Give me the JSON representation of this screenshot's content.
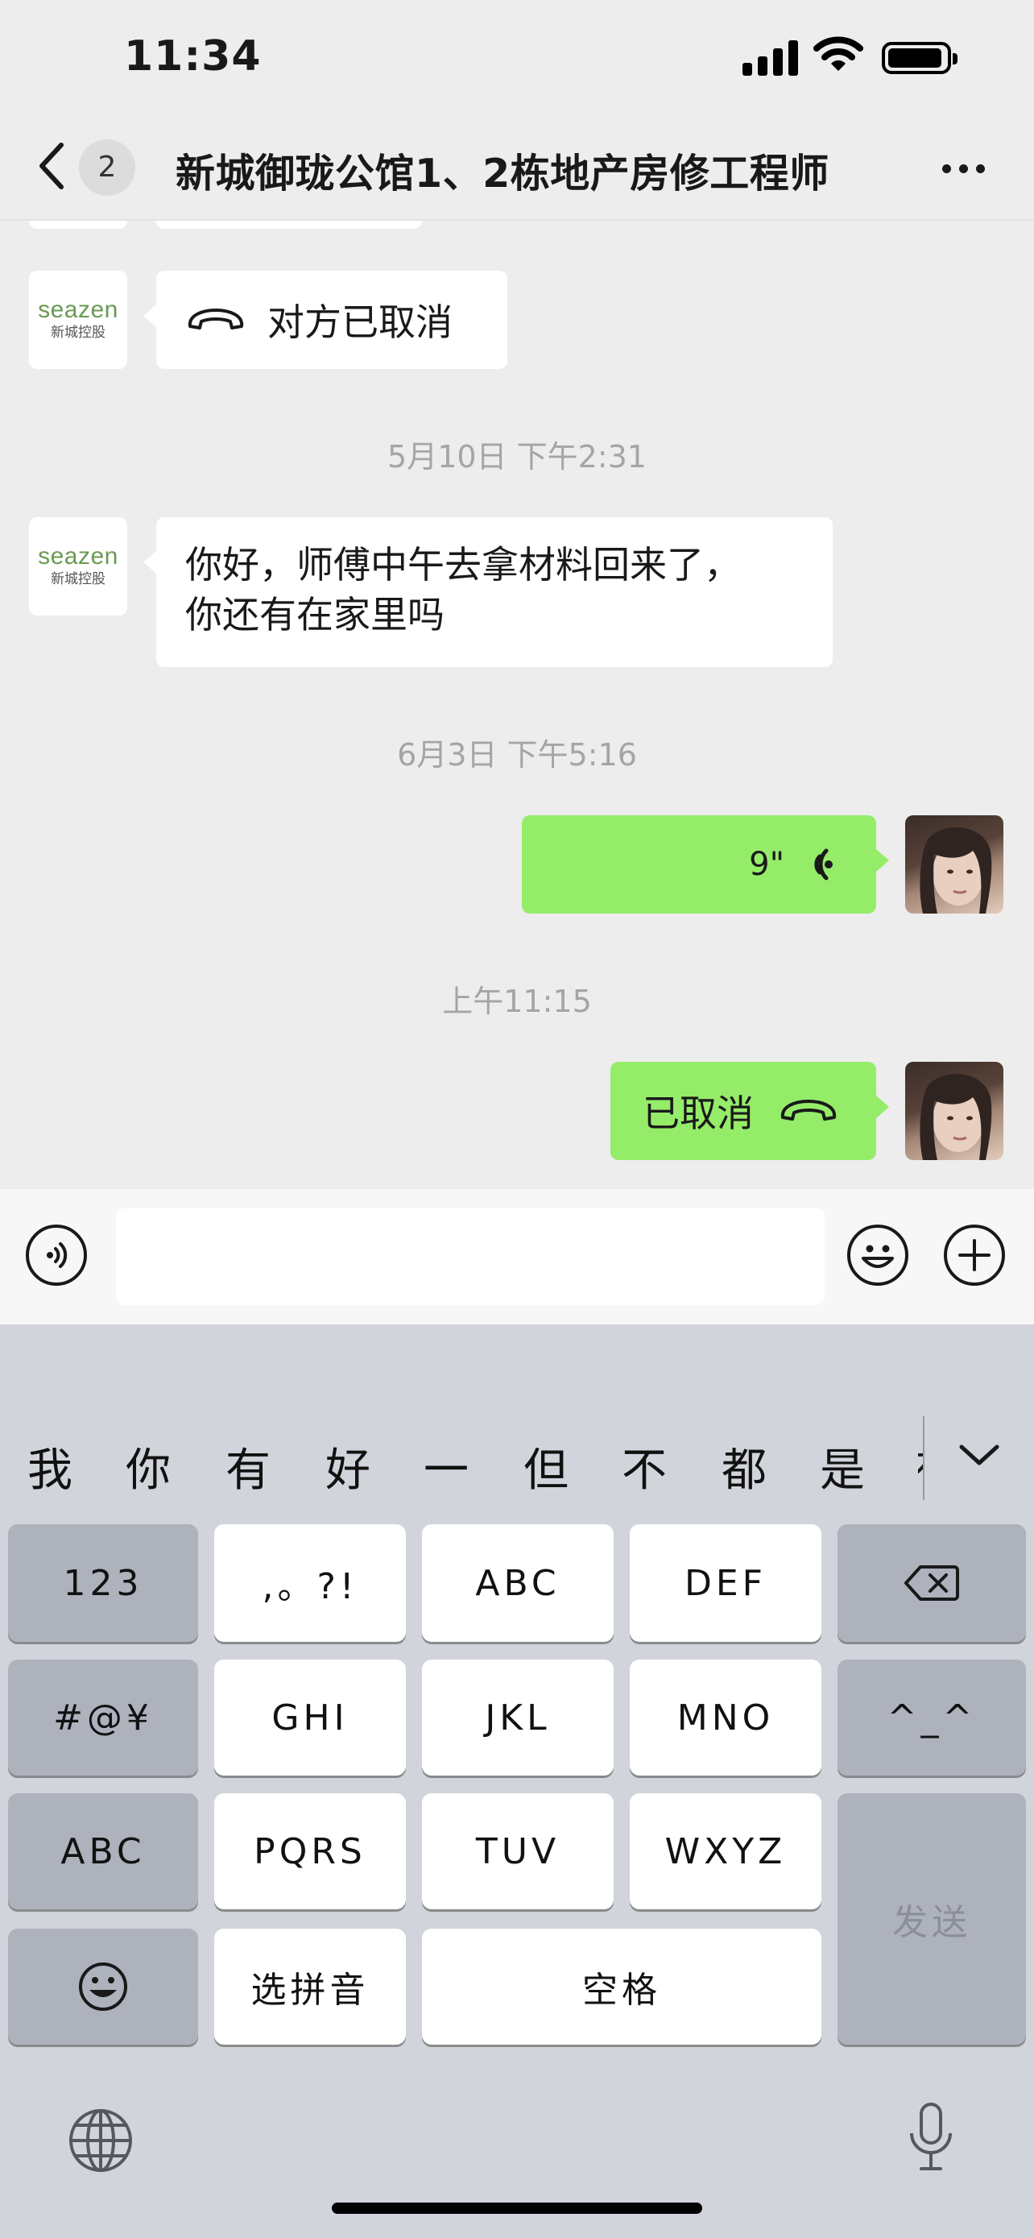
{
  "status_bar": {
    "time": "11:34"
  },
  "nav": {
    "unread_count": "2",
    "title": "新城御珑公馆1、2栋地产房修工程师"
  },
  "avatar_seazen": {
    "en": "seazen",
    "cn": "新城控股"
  },
  "messages": {
    "call_cancelled_other": "对方已取消",
    "ts_1": "5月10日 下午2:31",
    "text_1_line1": "你好，师傅中午去拿材料回来了，",
    "text_1_line2": "你还有在家里吗",
    "ts_2": "6月3日 下午5:16",
    "voice_duration": "9\"",
    "ts_3": "上午11:15",
    "call_cancelled_self": "已取消"
  },
  "candidates": [
    "我",
    "你",
    "有",
    "好",
    "一",
    "但",
    "不",
    "都",
    "是",
    "有"
  ],
  "keyboard": {
    "num": "123",
    "punct": ",。?!",
    "abc": "ABC",
    "def": "DEF",
    "symbols": "#@¥",
    "ghi": "GHI",
    "jkl": "JKL",
    "mno": "MNO",
    "emoticon": "^_^",
    "abc_switch": "ABC",
    "pqrs": "PQRS",
    "tuv": "TUV",
    "wxyz": "WXYZ",
    "send": "发送",
    "select_pinyin": "选拼音",
    "space": "空格"
  },
  "colors": {
    "bubble_green": "#95ec69",
    "chat_bg": "#ededed",
    "keyboard_bg": "#d1d4da"
  }
}
